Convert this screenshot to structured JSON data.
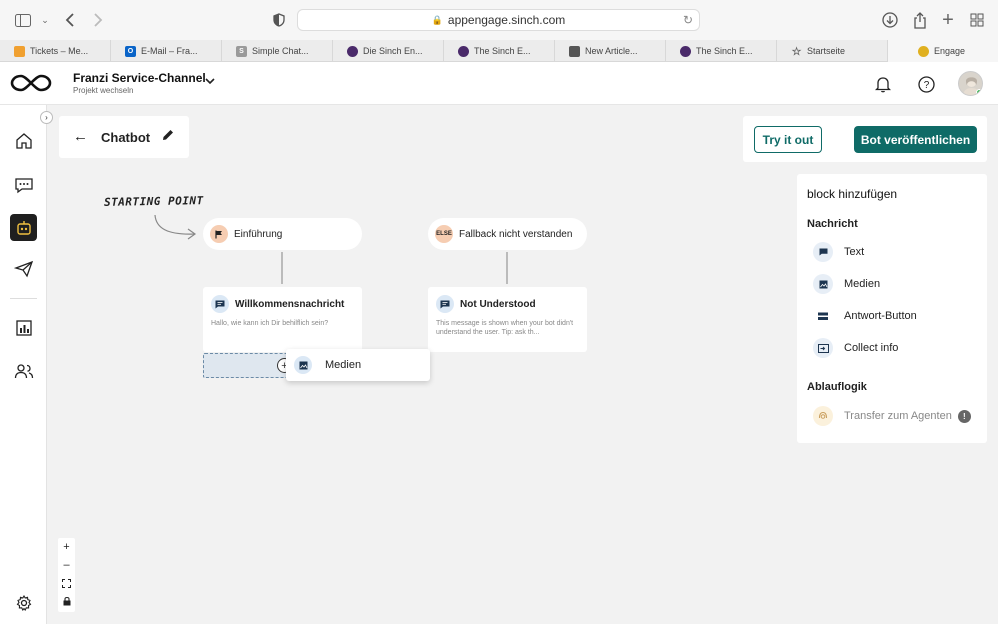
{
  "browser": {
    "url": "appengage.sinch.com",
    "tabs": [
      {
        "label": "Tickets – Me...",
        "color": "#f0a030",
        "glyph": "",
        "active": false
      },
      {
        "label": "E-Mail – Fra...",
        "color": "#0a64c8",
        "glyph": "O",
        "active": false
      },
      {
        "label": "Simple Chat...",
        "color": "#9a9a9a",
        "glyph": "S",
        "active": false
      },
      {
        "label": "Die Sinch En...",
        "color": "#4a2a6a",
        "glyph": "",
        "active": false
      },
      {
        "label": "The Sinch E...",
        "color": "#4a2a6a",
        "glyph": "",
        "active": false
      },
      {
        "label": "New Article...",
        "color": "#555555",
        "glyph": "",
        "active": false
      },
      {
        "label": "The Sinch E...",
        "color": "#4a2a6a",
        "glyph": "",
        "active": false
      },
      {
        "label": "Startseite",
        "color": "#ececec",
        "glyph": "☆",
        "active": false
      },
      {
        "label": "Engage",
        "color": "#e0b020",
        "glyph": "",
        "active": true
      }
    ]
  },
  "header": {
    "project_title": "Franzi Service-Channel",
    "project_subtitle": "Projekt wechseln"
  },
  "canvas": {
    "title": "Chatbot",
    "try_label": "Try it out",
    "publish_label": "Bot veröffentlichen",
    "starting_point": "STARTING POINT",
    "flows": [
      {
        "pill_label": "Einführung",
        "pill_icon": "flag",
        "card_title": "Willkommensnachricht",
        "card_text": "Hallo, wie kann ich Dir behilflich sein?"
      },
      {
        "pill_label": "Fallback nicht verstanden",
        "pill_icon": "ELSE",
        "card_title": "Not Understood",
        "card_text": "This message is shown when your bot didn't understand the user. Tip: ask th..."
      }
    ],
    "drag_label": "Medien"
  },
  "panel": {
    "title": "block hinzufügen",
    "sections": [
      {
        "title": "Nachricht",
        "items": [
          "Text",
          "Medien",
          "Antwort-Button",
          "Collect info"
        ]
      },
      {
        "title": "Ablauflogik",
        "items": [
          "Transfer zum Agenten"
        ]
      }
    ]
  },
  "zoom": {
    "plus": "+",
    "minus": "–"
  }
}
